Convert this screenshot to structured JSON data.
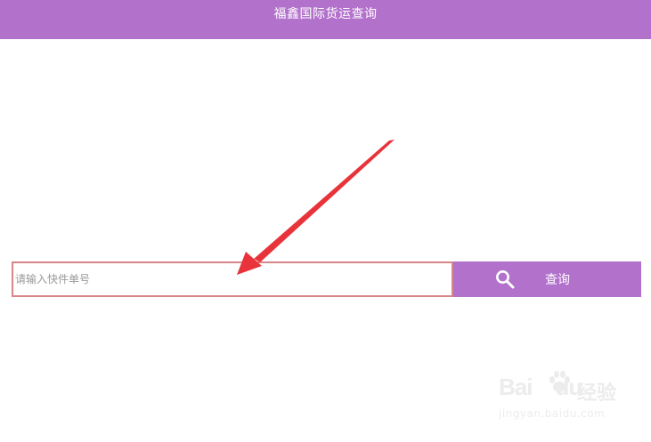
{
  "header": {
    "title": "福鑫国际货运查询"
  },
  "search": {
    "placeholder": "请输入快件单号",
    "value": "",
    "button_label": "查询",
    "button_icon": "search-icon"
  },
  "annotation": {
    "arrow_color": "#e8333a"
  },
  "watermark": {
    "logo_text": "Bai",
    "logo_text_tail": "du",
    "brand_cn": "经验",
    "url": "jingyan.baidu.com"
  },
  "colors": {
    "accent": "#b271cb",
    "input_border": "#d9868a"
  }
}
